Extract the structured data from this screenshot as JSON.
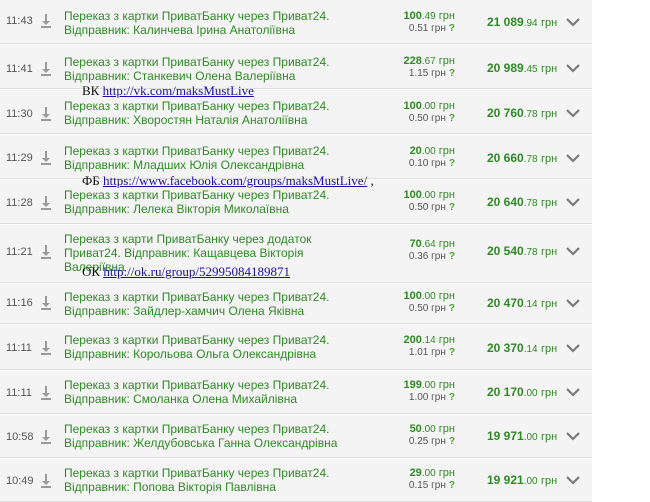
{
  "transactions": [
    {
      "time": "11:43",
      "line1": "Переказ з картки ПриватБанку через Приват24.",
      "line2": "Відправник: Калинчева Ірина Анатоліївна",
      "line3": "",
      "amt_int": "100",
      "amt_dec": ".49",
      "fee": "0.51",
      "bal_int": "21 089",
      "bal_dec": ".94"
    },
    {
      "time": "11:41",
      "line1": "Переказ з картки ПриватБанку через Приват24.",
      "line2": "Відправник: Станкевич Олена Валеріївна",
      "line3": "",
      "amt_int": "228",
      "amt_dec": ".67",
      "fee": "1.15",
      "bal_int": "20 989",
      "bal_dec": ".45"
    },
    {
      "time": "11:30",
      "line1": "Переказ з картки ПриватБанку через Приват24.",
      "line2": "Відправник: Хворостян Наталія Анатоліївна",
      "line3": "",
      "amt_int": "100",
      "amt_dec": ".00",
      "fee": "0.50",
      "bal_int": "20 760",
      "bal_dec": ".78"
    },
    {
      "time": "11:29",
      "line1": "Переказ з картки ПриватБанку через Приват24.",
      "line2": "Відправник: Младших Юлія Олександрівна",
      "line3": "",
      "amt_int": "20",
      "amt_dec": ".00",
      "fee": "0.10",
      "bal_int": "20 660",
      "bal_dec": ".78"
    },
    {
      "time": "11:28",
      "line1": "Переказ з картки ПриватБанку через Приват24.",
      "line2": "Відправник: Лелека Вікторія Миколаївна",
      "line3": "",
      "amt_int": "100",
      "amt_dec": ".00",
      "fee": "0.50",
      "bal_int": "20 640",
      "bal_dec": ".78"
    },
    {
      "time": "11:21",
      "line1": "Переказ з карти ПриватБанку через додаток",
      "line2": "Приват24. Відправник: Кащавцева Вікторія",
      "line3": "Валеріївна",
      "amt_int": "70",
      "amt_dec": ".64",
      "fee": "0.36",
      "bal_int": "20 540",
      "bal_dec": ".78"
    },
    {
      "time": "11:16",
      "line1": "Переказ з картки ПриватБанку через Приват24.",
      "line2": "Відправник: Зайдлер-хамчич Олена Яківна",
      "line3": "",
      "amt_int": "100",
      "amt_dec": ".00",
      "fee": "0.50",
      "bal_int": "20 470",
      "bal_dec": ".14"
    },
    {
      "time": "11:11",
      "line1": "Переказ з картки ПриватБанку через Приват24.",
      "line2": "Відправник: Корольова Ольга Олександрівна",
      "line3": "",
      "amt_int": "200",
      "amt_dec": ".14",
      "fee": "1.01",
      "bal_int": "20 370",
      "bal_dec": ".14"
    },
    {
      "time": "11:11",
      "line1": "Переказ з картки ПриватБанку через Приват24.",
      "line2": "Відправник: Смоланка Олена Михайлівна",
      "line3": "",
      "amt_int": "199",
      "amt_dec": ".00",
      "fee": "1.00",
      "bal_int": "20 170",
      "bal_dec": ".00"
    },
    {
      "time": "10:58",
      "line1": "Переказ з картки ПриватБанку через Приват24.",
      "line2": "Відправник: Желдубовська Ганна Олександрівна",
      "line3": "",
      "amt_int": "50",
      "amt_dec": ".00",
      "fee": "0.25",
      "bal_int": "19 971",
      "bal_dec": ".00"
    },
    {
      "time": "10:49",
      "line1": "Переказ з картки ПриватБанку через Приват24.",
      "line2": "Відправник: Попова Вікторія Павлівна",
      "line3": "",
      "amt_int": "29",
      "amt_dec": ".00",
      "fee": "0.15",
      "bal_int": "19 921",
      "bal_dec": ".00"
    }
  ],
  "labels": {
    "currency": "грн",
    "fee_hint": "?"
  },
  "overlays": {
    "vk": {
      "prefix": "ВК",
      "link": "http://vk.com/maksMustLive",
      "suffix": ""
    },
    "fb": {
      "prefix": "ФБ",
      "link": "https://www.facebook.com/groups/maksMustLive/",
      "suffix": ","
    },
    "ok": {
      "prefix": "ОК",
      "link": "http://ok.ru/group/52995084189871",
      "suffix": ""
    }
  },
  "colors": {
    "text_green": "#2f8a25",
    "row_bg": "#f4f4f4",
    "row_border": "#dddddd",
    "link": "#1a0dab"
  }
}
